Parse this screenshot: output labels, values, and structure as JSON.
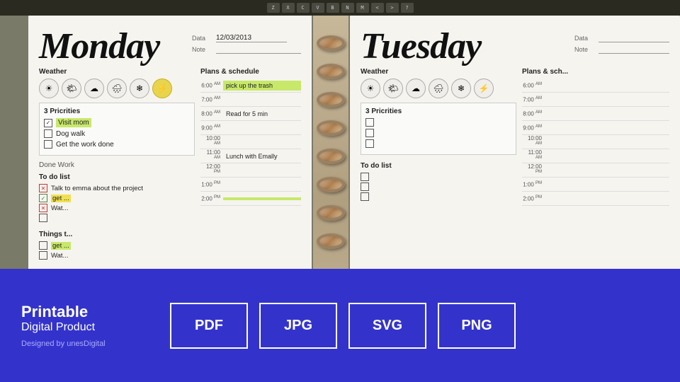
{
  "keyboard": {
    "keys": [
      "Z",
      "X",
      "C",
      "V",
      "B",
      "N",
      "M",
      "<",
      ">",
      "?"
    ]
  },
  "monday": {
    "day": "Monday",
    "date_label": "Data",
    "date_value": "12/03/2013",
    "note_label": "Note",
    "weather_label": "Weather",
    "weather_icons": [
      "☀",
      "🌤",
      "☁",
      "☁",
      "❄",
      "⚡"
    ],
    "weather_active_index": 5,
    "priorities_title": "3 Pricrities",
    "priorities": [
      {
        "checked": true,
        "label": "Visit mom",
        "highlight": true
      },
      {
        "checked": false,
        "label": "Dog walk",
        "highlight": false
      },
      {
        "checked": false,
        "label": "Get the work done",
        "highlight": false
      }
    ],
    "todo_title": "To do list",
    "todos": [
      {
        "state": "x",
        "label": "Talk to emma about the project",
        "highlight": "none"
      },
      {
        "state": "check",
        "label": "get ...",
        "highlight": "yellow"
      },
      {
        "state": "x",
        "label": "Wat...",
        "highlight": "none"
      },
      {
        "state": "none",
        "label": "",
        "highlight": "none"
      }
    ],
    "things_title": "Things t...",
    "things": [
      {
        "state": "none",
        "label": "get ...",
        "highlight": "green"
      },
      {
        "state": "none",
        "label": "Wat...",
        "highlight": "none"
      }
    ],
    "plans_title": "Plans & schedule",
    "schedule": [
      {
        "time": "6:00",
        "period": "AM",
        "content": "pick up the trash",
        "highlight": true
      },
      {
        "time": "7:00",
        "period": "AM",
        "content": "",
        "highlight": false
      },
      {
        "time": "8:00",
        "period": "AM",
        "content": "Read for 5 min",
        "highlight": false
      },
      {
        "time": "9:00",
        "period": "AM",
        "content": "",
        "highlight": false
      },
      {
        "time": "10:00",
        "period": "AM",
        "content": "",
        "highlight": false
      },
      {
        "time": "11:00",
        "period": "AM",
        "content": "Lunch with Emally",
        "highlight": false
      },
      {
        "time": "12:00",
        "period": "PM",
        "content": "",
        "highlight": false
      },
      {
        "time": "1:00",
        "period": "PM",
        "content": "",
        "highlight": false
      },
      {
        "time": "2:00",
        "period": "PM",
        "content": "",
        "highlight": true
      }
    ]
  },
  "tuesday": {
    "day": "Tuesday",
    "date_label": "Data",
    "note_label": "Note",
    "weather_label": "Weather",
    "weather_icons": [
      "☀",
      "🌤",
      "☁",
      "☁",
      "❄",
      "⚡"
    ],
    "priorities_title": "3 Pricrities",
    "priorities": [
      {
        "checked": false,
        "label": "",
        "highlight": false
      },
      {
        "checked": false,
        "label": "",
        "highlight": false
      },
      {
        "checked": false,
        "label": "",
        "highlight": false
      }
    ],
    "todo_title": "To do list",
    "plans_title": "Plans & sch...",
    "schedule": [
      {
        "time": "6:00",
        "period": "AM",
        "content": "",
        "highlight": false
      },
      {
        "time": "7:00",
        "period": "AM",
        "content": "",
        "highlight": false
      },
      {
        "time": "8:00",
        "period": "AM",
        "content": "",
        "highlight": false
      },
      {
        "time": "9:00",
        "period": "AM",
        "content": "",
        "highlight": false
      },
      {
        "time": "10:00",
        "period": "AM",
        "content": "",
        "highlight": false
      },
      {
        "time": "11:00",
        "period": "AM",
        "content": "",
        "highlight": false
      },
      {
        "time": "12:00",
        "period": "PM",
        "content": "",
        "highlight": false
      },
      {
        "time": "1:00",
        "period": "PM",
        "content": "",
        "highlight": false
      },
      {
        "time": "2:00",
        "period": "PM",
        "content": "",
        "highlight": false
      }
    ]
  },
  "panel": {
    "title_bold": "Printable",
    "title_normal": "Digital Product",
    "designer": "Designed by unesDigital",
    "formats": [
      "PDF",
      "JPG",
      "SVG",
      "PNG"
    ]
  }
}
